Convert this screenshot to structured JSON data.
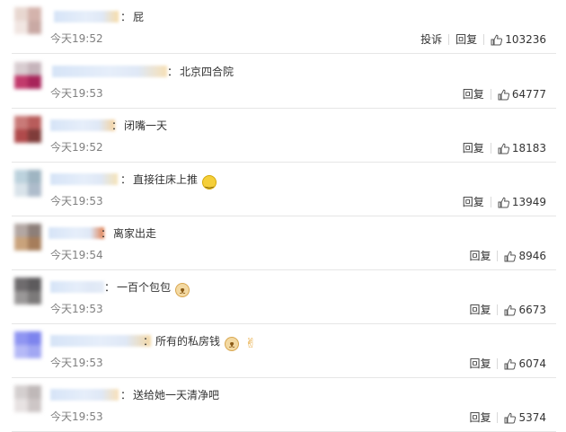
{
  "colors": {
    "time_gray": "#808080",
    "text": "#333333",
    "separator": "#e6e6e6"
  },
  "actions": {
    "report": "投诉",
    "reply": "回复",
    "colon": "："
  },
  "comments": [
    {
      "text": "屁",
      "time": "今天19:52",
      "likes": "103236",
      "has_report": true,
      "emoji": "",
      "emoji2": "",
      "colon": "："
    },
    {
      "text": "北京四合院",
      "time": "今天19:53",
      "likes": "64777",
      "has_report": false,
      "emoji": "",
      "emoji2": "",
      "colon": "："
    },
    {
      "text": "闭嘴一天",
      "time": "今天19:52",
      "likes": "18183",
      "has_report": false,
      "emoji": "",
      "emoji2": "",
      "colon": "："
    },
    {
      "text": "直接往床上推",
      "time": "今天19:53",
      "likes": "13949",
      "has_report": false,
      "emoji": "smile-emoji",
      "emoji2": "",
      "colon": "："
    },
    {
      "text": "离家出走",
      "time": "今天19:54",
      "likes": "8946",
      "has_report": false,
      "emoji": "",
      "emoji2": "",
      "colon": "："
    },
    {
      "text": "一百个包包",
      "time": "今天19:53",
      "likes": "6673",
      "has_report": false,
      "emoji": "dog-emoji",
      "emoji2": "",
      "colon": "："
    },
    {
      "text": "所有的私房钱",
      "time": "今天19:53",
      "likes": "6074",
      "has_report": false,
      "emoji": "dog-emoji",
      "emoji2": "victory-hand-emoji",
      "colon": "："
    },
    {
      "text": "送给她一天清净吧",
      "time": "今天19:53",
      "likes": "5374",
      "has_report": false,
      "emoji": "",
      "emoji2": "",
      "colon": "："
    }
  ]
}
